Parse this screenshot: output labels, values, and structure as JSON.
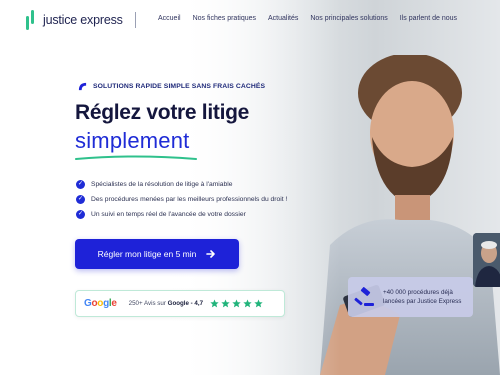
{
  "header": {
    "logo_text": "justice express",
    "nav": [
      "Accueil",
      "Nos fiches pratiques",
      "Actualités",
      "Nos principales solutions",
      "Ils parlent de nous"
    ]
  },
  "hero": {
    "tag": "SOLUTIONS RAPIDE SIMPLE SANS FRAIS CACHÉS",
    "title_line1": "Réglez votre litige",
    "title_line2": "simplement",
    "bullets": [
      "Spécialistes de la résolution de litige à l'amiable",
      "Des procédures menées par les meilleurs professionnels du droit !",
      "Un suivi en temps réel de l'avancée de votre dossier"
    ],
    "cta_label": "Régler mon litige en 5 min"
  },
  "reviews": {
    "google_letters": [
      "G",
      "o",
      "o",
      "g",
      "l",
      "e"
    ],
    "text_prefix": "250+ Avis sur",
    "text_brand": "Google - 4,7",
    "rating": 5
  },
  "badge": {
    "line1": "+40 000 procédures déjà",
    "line2": "lancées par Justice Express"
  },
  "colors": {
    "accent_blue": "#1e22d8",
    "brand_green": "#2fc18c",
    "dark_text": "#14163d"
  },
  "icons": [
    "logo-mark-icon",
    "tag-icon",
    "check-icon",
    "arrow-right-icon",
    "star-icon",
    "gavel-icon"
  ]
}
